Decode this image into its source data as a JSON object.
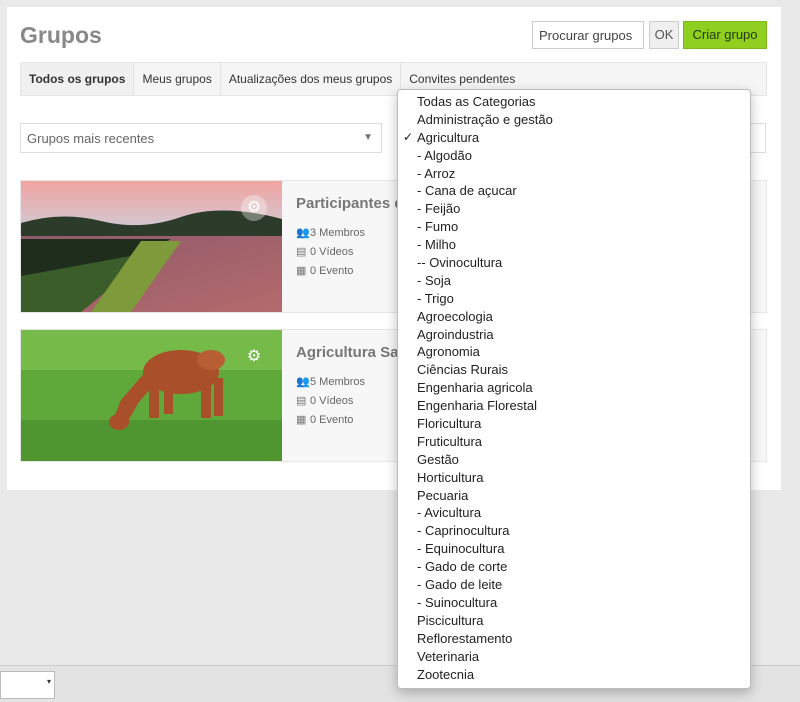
{
  "header": {
    "title": "Grupos",
    "search_value": "Procurar grupos",
    "ok_label": "OK",
    "create_label": "Criar grupo"
  },
  "tabs": [
    {
      "label": "Todos os grupos",
      "active": true
    },
    {
      "label": "Meus grupos"
    },
    {
      "label": "Atualizações dos meus grupos"
    },
    {
      "label": "Convites pendentes"
    }
  ],
  "sort": {
    "value": "Grupos mais recentes"
  },
  "groups": [
    {
      "title": "Participantes d",
      "members": "3 Membros",
      "videos": "0 Vídeos",
      "events": "0 Evento"
    },
    {
      "title": "Agricultura Sar",
      "members": "5 Membros",
      "videos": "0 Vídeos",
      "events": "0 Evento"
    }
  ],
  "category_dropdown": {
    "selected": "Agricultura",
    "options": [
      "Todas as Categorias",
      "Administração e gestão",
      "Agricultura",
      "- Algodão",
      "- Arroz",
      "- Cana de açucar",
      "- Feijão",
      "- Fumo",
      "- Milho",
      "-- Ovinocultura",
      "- Soja",
      "- Trigo",
      "Agroecologia",
      "Agroindustria",
      "Agronomia",
      "Ciências Rurais",
      "Engenharia agricola",
      "Engenharia Florestal",
      "Floricultura",
      "Fruticultura",
      "Gestão",
      "Horticultura",
      "Pecuaria",
      "- Avicultura",
      "- Caprinocultura",
      "- Equinocultura",
      "- Gado de corte",
      "- Gado de leite",
      "- Suinocultura",
      "Piscicultura",
      "Reflorestamento",
      "Veterinaria",
      "Zootecnia"
    ]
  },
  "icons": {
    "gear": "gear-icon",
    "members": "users-icon",
    "videos": "film-icon",
    "events": "calendar-icon",
    "check": "checkmark-icon"
  }
}
